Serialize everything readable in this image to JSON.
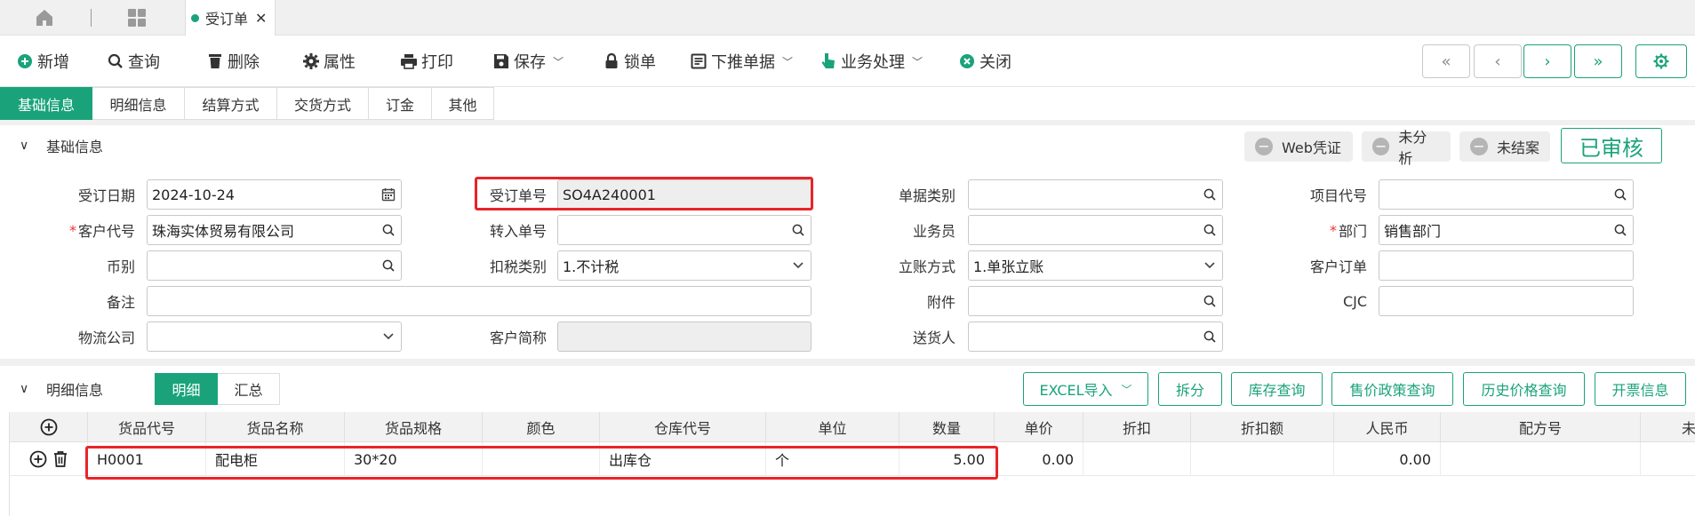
{
  "tabs": {
    "active_tab": "受订单",
    "close": "✕"
  },
  "toolbar": {
    "add": "新增",
    "query": "查询",
    "delete": "删除",
    "attributes": "属性",
    "print": "打印",
    "save": "保存",
    "lock": "锁单",
    "push_down": "下推单据",
    "business": "业务处理",
    "close": "关闭"
  },
  "subtabs": [
    "基础信息",
    "明细信息",
    "结算方式",
    "交货方式",
    "订金",
    "其他"
  ],
  "basic": {
    "section_title": "基础信息",
    "flags": {
      "web_voucher": "Web凭证",
      "not_analyzed": "未分析",
      "not_closed": "未结案"
    },
    "approved": "已审核",
    "labels": {
      "order_date": "受订日期",
      "order_no": "受订单号",
      "doc_type": "单据类别",
      "project_code": "项目代号",
      "customer_code": "客户代号",
      "transfer_no": "转入单号",
      "salesman": "业务员",
      "department": "部门",
      "currency": "币别",
      "tax_type": "扣税类别",
      "account_method": "立账方式",
      "customer_order": "客户订单",
      "remark": "备注",
      "attachment": "附件",
      "cjc": "CJC",
      "logistics": "物流公司",
      "customer_short": "客户简称",
      "deliverer": "送货人"
    },
    "values": {
      "order_date": "2024-10-24",
      "order_no": "SO4A240001",
      "customer_code": "珠海实体贸易有限公司",
      "department": "销售部门",
      "tax_type": "1.不计税",
      "account_method": "1.单张立账"
    }
  },
  "detail": {
    "section_title": "明细信息",
    "seg_detail": "明细",
    "seg_summary": "汇总",
    "actions": {
      "excel_import": "EXCEL导入",
      "split": "拆分",
      "stock_query": "库存查询",
      "price_policy": "售价政策查询",
      "history_price": "历史价格查询",
      "invoice_info": "开票信息"
    },
    "columns": [
      "货品代号",
      "货品名称",
      "货品规格",
      "颜色",
      "仓库代号",
      "单位",
      "数量",
      "单价",
      "折扣",
      "折扣额",
      "人民币",
      "配方号",
      "未"
    ],
    "rows": [
      {
        "code": "H0001",
        "name": "配电柜",
        "spec": "30*20",
        "color": "",
        "warehouse": "出库仓",
        "unit": "个",
        "qty": "5.00",
        "price": "0.00",
        "discount": "",
        "discount_amt": "",
        "rmb": "0.00",
        "formula": ""
      }
    ]
  }
}
